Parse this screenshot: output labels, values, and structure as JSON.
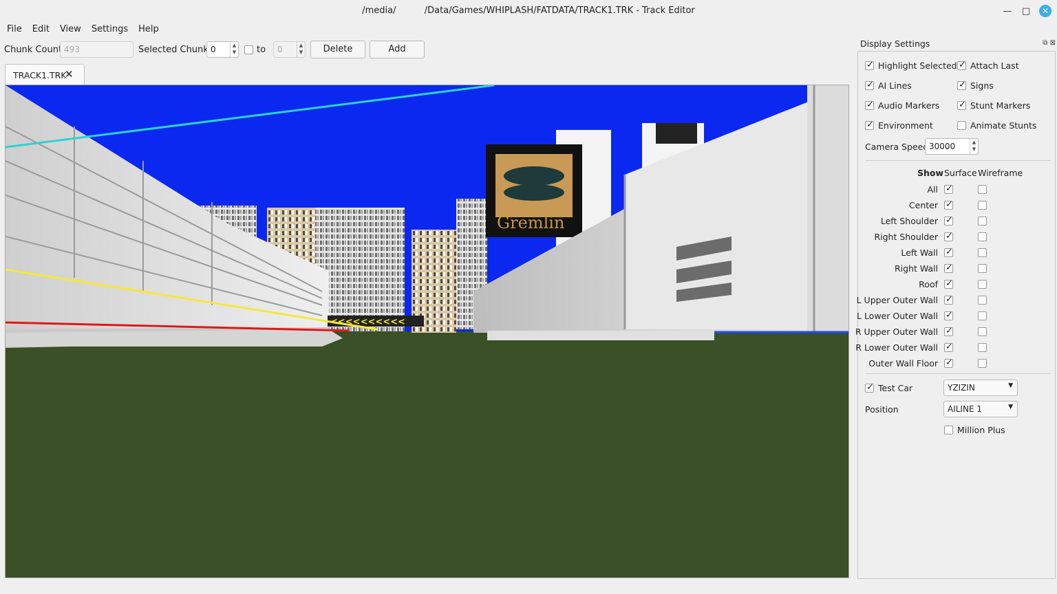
{
  "window": {
    "title": "/media/          /Data/Games/WHIPLASH/FATDATA/TRACK1.TRK - Track Editor"
  },
  "menu": [
    "File",
    "Edit",
    "View",
    "Settings",
    "Help"
  ],
  "toolbar": {
    "chunk_count_label": "Chunk Count",
    "chunk_count_value": "493",
    "selected_chunks_label": "Selected Chunks",
    "selected_from": "0",
    "to_label": "to",
    "selected_to": "0",
    "delete_label": "Delete",
    "add_label": "Add"
  },
  "tab": {
    "label": "TRACK1.TRK"
  },
  "viewport": {
    "billboard_text": "Gremlin",
    "colors": {
      "sky": "#0a28f0",
      "ground": "#3a5026",
      "ai_line_cyan": "#2ad4d4",
      "ai_line_yellow": "#f5e83a",
      "ai_line_red": "#e01818"
    }
  },
  "dock": {
    "title": "Display Settings",
    "toggles": [
      {
        "label": "Highlight Selected",
        "checked": true
      },
      {
        "label": "Attach Last",
        "checked": true
      },
      {
        "label": "AI Lines",
        "checked": true
      },
      {
        "label": "Signs",
        "checked": true
      },
      {
        "label": "Audio Markers",
        "checked": true
      },
      {
        "label": "Stunt Markers",
        "checked": true
      },
      {
        "label": "Environment",
        "checked": true
      },
      {
        "label": "Animate Stunts",
        "checked": false
      }
    ],
    "camera_speed_label": "Camera Speed",
    "camera_speed_value": "30000",
    "columns": {
      "show": "Show",
      "surface": "Surface",
      "wireframe": "Wireframe"
    },
    "surfaces": [
      {
        "label": "All",
        "surface": true,
        "wireframe": false
      },
      {
        "label": "Center",
        "surface": true,
        "wireframe": false
      },
      {
        "label": "Left Shoulder",
        "surface": true,
        "wireframe": false
      },
      {
        "label": "Right Shoulder",
        "surface": true,
        "wireframe": false
      },
      {
        "label": "Left Wall",
        "surface": true,
        "wireframe": false
      },
      {
        "label": "Right Wall",
        "surface": true,
        "wireframe": false
      },
      {
        "label": "Roof",
        "surface": true,
        "wireframe": false
      },
      {
        "label": "L Upper Outer Wall",
        "surface": true,
        "wireframe": false
      },
      {
        "label": "L Lower Outer Wall",
        "surface": true,
        "wireframe": false
      },
      {
        "label": "R Upper Outer Wall",
        "surface": true,
        "wireframe": false
      },
      {
        "label": "R Lower Outer Wall",
        "surface": true,
        "wireframe": false
      },
      {
        "label": "Outer Wall Floor",
        "surface": true,
        "wireframe": false
      }
    ],
    "test_car": {
      "label": "Test Car",
      "checked": true,
      "value": "YZIZIN"
    },
    "position": {
      "label": "Position",
      "value": "AILINE 1"
    },
    "million_plus": {
      "label": "Million Plus",
      "checked": false
    }
  }
}
